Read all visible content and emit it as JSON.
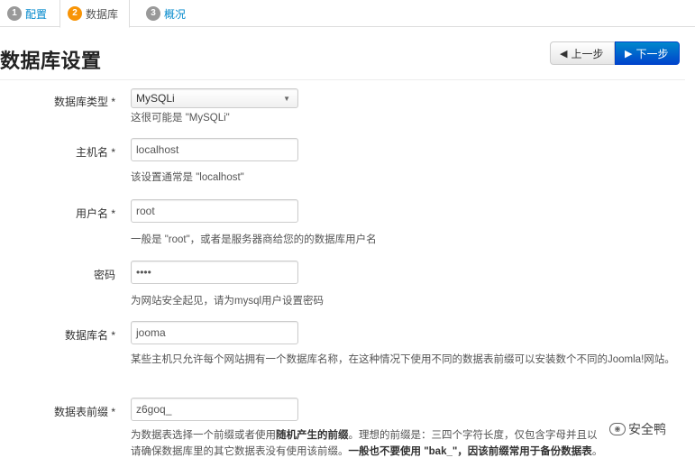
{
  "tabs": [
    {
      "num": "1",
      "label": "配置"
    },
    {
      "num": "2",
      "label": "数据库"
    },
    {
      "num": "3",
      "label": "概况"
    }
  ],
  "page": {
    "title": "数据库设置"
  },
  "nav": {
    "prev_label": "上一步",
    "next_label": "下一步"
  },
  "form": {
    "db_type": {
      "label": "数据库类型 *",
      "value": "MySQLi",
      "help": "这很可能是 \"MySQLi\""
    },
    "host": {
      "label": "主机名 *",
      "value": "localhost",
      "help": "该设置通常是 \"localhost\""
    },
    "user": {
      "label": "用户名 *",
      "value": "root",
      "help": "一般是 \"root\"，或者是服务器商给您的的数据库用户名"
    },
    "password": {
      "label": "密码",
      "value": "••••",
      "help": "为网站安全起见，请为mysql用户设置密码"
    },
    "db_name": {
      "label": "数据库名 *",
      "value": "jooma",
      "help": "某些主机只允许每个网站拥有一个数据库名称，在这种情况下使用不同的数据表前缀可以安装数个不同的Joomla!网站。"
    },
    "prefix": {
      "label": "数据表前缀 *",
      "value": "z6goq_",
      "help_1a": "为数据表选择一个前缀或者使用",
      "help_1b": "随机产生的前缀",
      "help_1c": "。理想的前缀是：三四个字符长度，仅包含字母并且以",
      "help_2a": "请确保数据库里的其它数据表没有使用该前缀。",
      "help_2b": "一般也不要使用 \"bak_\"，因该前缀常用于备份数据表",
      "help_2c": "。"
    }
  },
  "watermark": {
    "text": "安全鸭"
  },
  "colors": {
    "accent": "#0088cc",
    "active_step": "#f89406",
    "next_button": "#0055cc"
  }
}
